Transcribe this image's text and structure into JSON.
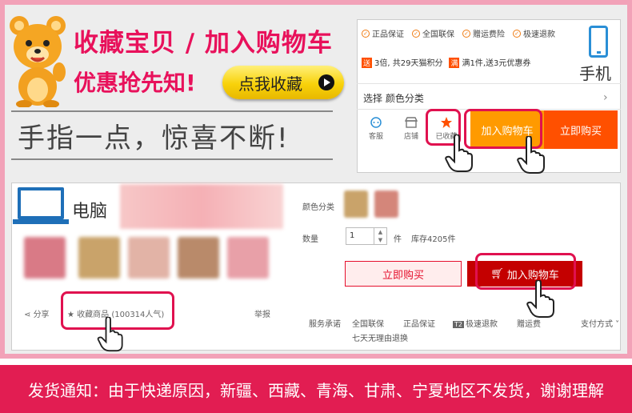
{
  "header": {
    "headline": "收藏宝贝 / 加入购物车",
    "subheadline": "优惠抢先知!",
    "fav_button": "点我收藏",
    "tagline": "手指一点，惊喜不断!"
  },
  "phone": {
    "label": "手机",
    "guarantees": [
      "正品保证",
      "全国联保",
      "赠运费险",
      "极速退款"
    ],
    "promos": [
      {
        "tag": "送",
        "text": "3倍, 共29天猫积分"
      },
      {
        "tag": "满",
        "text": "满1件,送3元优惠券"
      }
    ],
    "select_label": "选择  颜色分类",
    "bottom_items": [
      "客服",
      "店铺",
      "已收藏"
    ],
    "add_cart": "加入购物车",
    "buy_now": "立即购买"
  },
  "pc": {
    "label": "电脑",
    "color_label": "颜色分类",
    "qty_label": "数量",
    "qty_value": "1",
    "qty_unit": "件",
    "stock": "库存4205件",
    "buy_now": "立即购买",
    "add_cart": "加入购物车",
    "share": "分享",
    "favorite": "收藏商品 (100314人气)",
    "report": "举报",
    "services_label": "服务承诺",
    "services": [
      "全国联保",
      "正品保证",
      "极速退款",
      "赠运费"
    ],
    "refund": "七天无理由退换",
    "payment": "支付方式"
  },
  "notice": "发货通知：由于快递原因，新疆、西藏、青海、甘肃、宁夏地区不发货，谢谢理解",
  "colors": {
    "accent": "#e8115b",
    "frame": "#f2a2b8",
    "cart_orange": "#ff9a00",
    "buy_orange": "#ff5000",
    "tmall_red": "#c40000",
    "notice_bg": "#e21d52"
  }
}
